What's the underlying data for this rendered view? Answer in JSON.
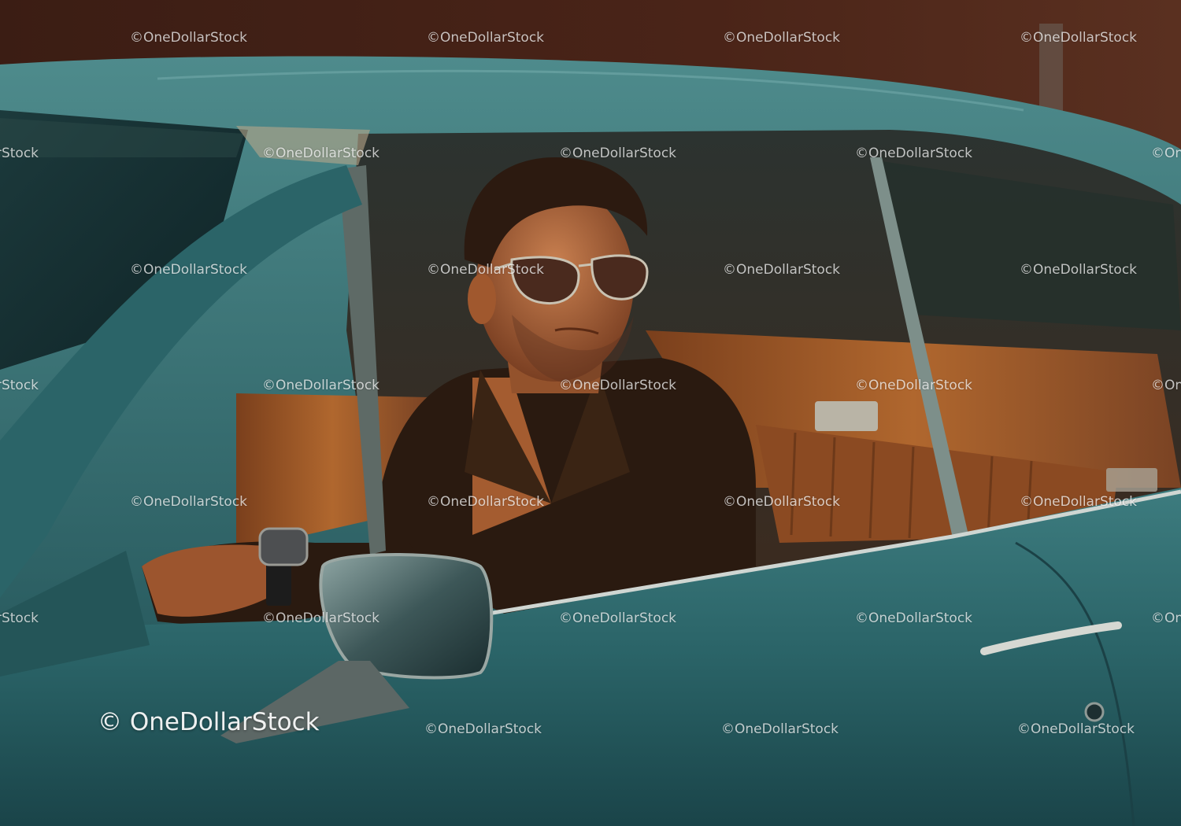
{
  "photo": {
    "subject": "man-in-vintage-car",
    "palette": {
      "car_teal": "#2f6f72",
      "car_teal_dark": "#173f44",
      "car_highlight": "#6aa3a3",
      "interior_leather": "#a05a2a",
      "sky_brick": "#3a1f17",
      "skin": "#b86a3c",
      "jacket": "#2a1a10",
      "chrome": "#c9c2b2"
    }
  },
  "watermark": {
    "main": "© OneDollarStock",
    "tile": "©OneDollarStock"
  }
}
